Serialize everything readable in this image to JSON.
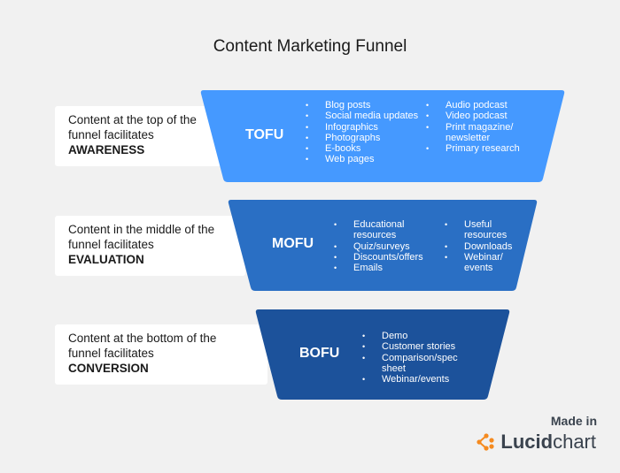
{
  "title": "Content Marketing Funnel",
  "colors": {
    "tofu": "#4599ff",
    "mofu": "#2a6fc4",
    "bofu": "#1c529b",
    "background": "#f1f1f1",
    "logo_accent": "#f58a1f"
  },
  "stages": [
    {
      "key": "tofu",
      "name": "TOFU",
      "label_lines": [
        "Content at the top of the",
        "funnel facilitates"
      ],
      "label_stage": "AWARENESS",
      "columns": [
        [
          "Blog posts",
          "Social media updates",
          "Infographics",
          "Photographs",
          "E-books",
          "Web pages"
        ],
        [
          "Audio podcast",
          "Video podcast",
          "Print magazine/ newsletter",
          "Primary research"
        ]
      ]
    },
    {
      "key": "mofu",
      "name": "MOFU",
      "label_lines": [
        "Content in the middle of the",
        "funnel facilitates"
      ],
      "label_stage": "EVALUATION",
      "columns": [
        [
          "Educational resources",
          "Quiz/surveys",
          "Discounts/offers",
          "Emails"
        ],
        [
          "Useful resources",
          "Downloads",
          "Webinar/ events"
        ]
      ]
    },
    {
      "key": "bofu",
      "name": "BOFU",
      "label_lines": [
        "Content at the bottom of the",
        "funnel facilitates"
      ],
      "label_stage": "CONVERSION",
      "columns": [
        [
          "Demo",
          "Customer stories",
          "Comparison/spec sheet",
          "Webinar/events"
        ]
      ]
    }
  ],
  "branding": {
    "made_in": "Made in",
    "brand_bold": "Lucid",
    "brand_regular": "chart",
    "icon": "lucidchart-logo-icon"
  }
}
